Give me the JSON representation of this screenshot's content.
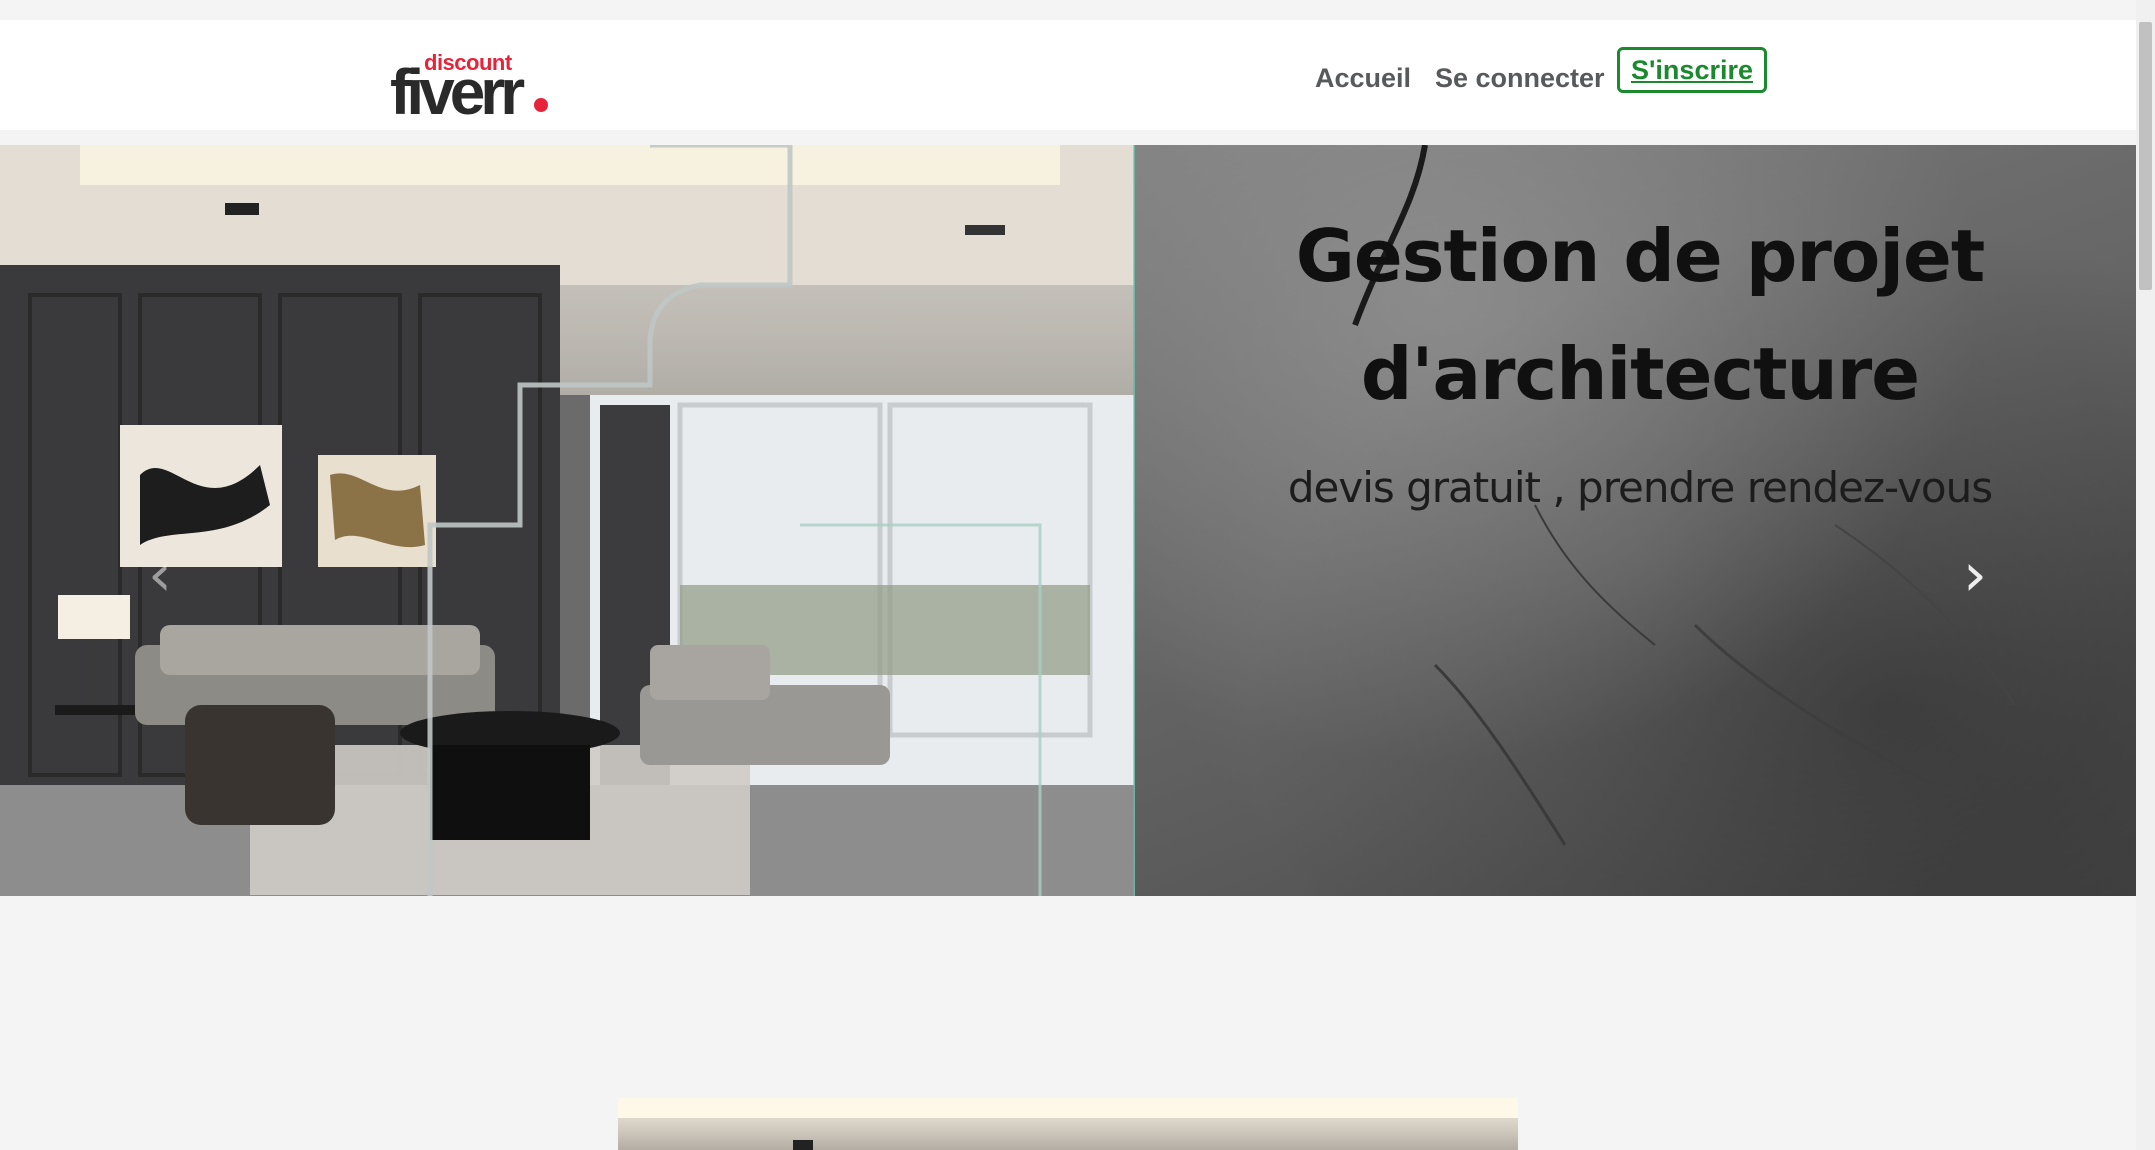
{
  "header": {
    "logo": {
      "small": "discount",
      "big": "fiverr"
    },
    "nav": {
      "home": "Accueil",
      "login": "Se connecter",
      "signup": "S'inscrire"
    }
  },
  "hero": {
    "title_line1": "Gestion de projet",
    "title_line2": "d'architecture",
    "subtitle": "devis gratuit , prendre rendez-vous",
    "prev_icon": "chevron-left-icon",
    "next_icon": "chevron-right-icon"
  },
  "colors": {
    "signup_border": "#1b8a2e",
    "brand_red": "#e6233b",
    "nav_text": "#58595b"
  }
}
